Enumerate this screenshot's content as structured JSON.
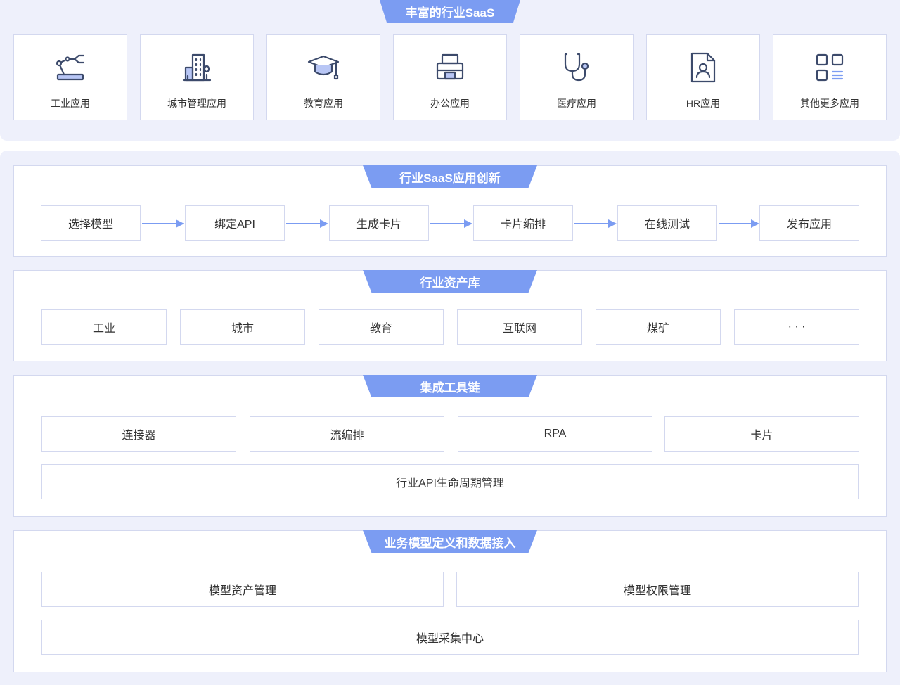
{
  "top": {
    "title": "丰富的行业SaaS",
    "apps": [
      {
        "label": "工业应用",
        "icon": "robot-arm-icon"
      },
      {
        "label": "城市管理应用",
        "icon": "building-icon"
      },
      {
        "label": "教育应用",
        "icon": "graduation-cap-icon"
      },
      {
        "label": "办公应用",
        "icon": "printer-icon"
      },
      {
        "label": "医疗应用",
        "icon": "stethoscope-icon"
      },
      {
        "label": "HR应用",
        "icon": "user-document-icon"
      },
      {
        "label": "其他更多应用",
        "icon": "grid-more-icon"
      }
    ]
  },
  "innovation": {
    "title": "行业SaaS应用创新",
    "steps": [
      "选择模型",
      "绑定API",
      "生成卡片",
      "卡片编排",
      "在线测试",
      "发布应用"
    ]
  },
  "assets": {
    "title": "行业资产库",
    "items": [
      "工业",
      "城市",
      "教育",
      "互联网",
      "煤矿",
      "· · ·"
    ]
  },
  "toolchain": {
    "title": "集成工具链",
    "items": [
      "连接器",
      "流编排",
      "RPA",
      "卡片"
    ],
    "wide": "行业API生命周期管理"
  },
  "model": {
    "title": "业务模型定义和数据接入",
    "items": [
      "模型资产管理",
      "模型权限管理"
    ],
    "wide": "模型采集中心"
  },
  "colors": {
    "accent": "#7b9cf2",
    "panel": "#eef0fb",
    "border": "#d3d8ef",
    "icon": "#3c4a6b"
  }
}
